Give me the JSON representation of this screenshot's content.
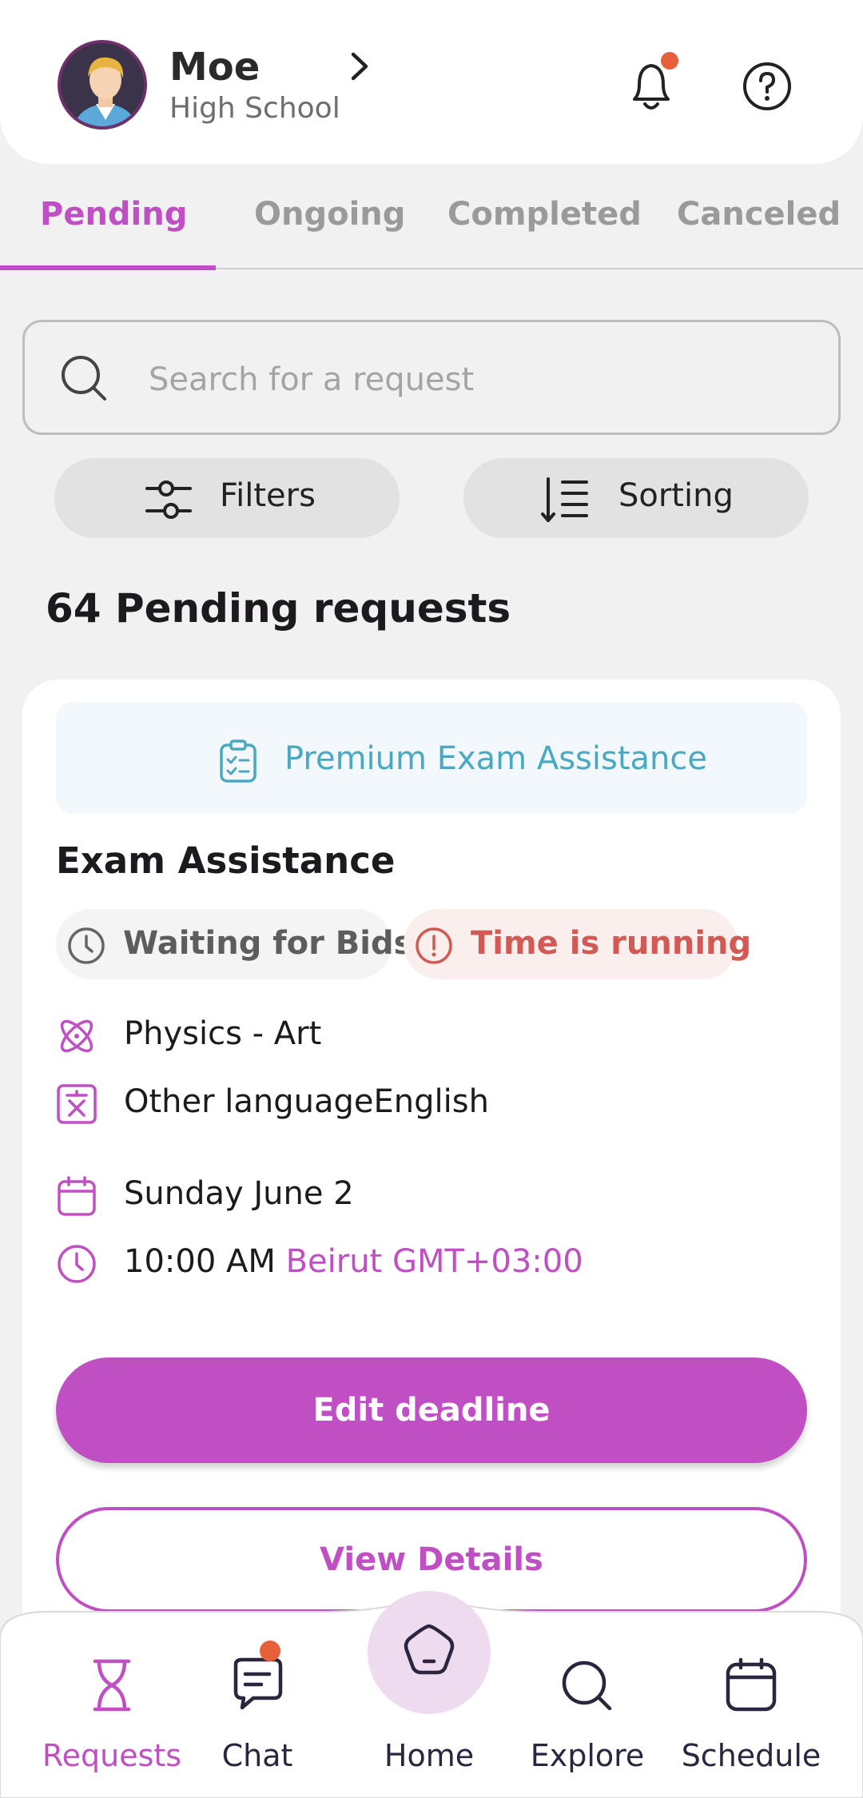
{
  "header": {
    "user_name": "Moe",
    "user_level": "High School",
    "icons": [
      "avatar",
      "chevron-right-icon",
      "bell-icon",
      "help-icon"
    ]
  },
  "tabs": [
    {
      "label": "Pending",
      "active": true
    },
    {
      "label": "Ongoing",
      "active": false
    },
    {
      "label": "Completed",
      "active": false
    },
    {
      "label": "Canceled",
      "active": false
    }
  ],
  "search": {
    "placeholder": "Search for a request",
    "value": ""
  },
  "toolbar": {
    "filters_label": "Filters",
    "sorting_label": "Sorting"
  },
  "summary": {
    "count_text": "64 Pending requests"
  },
  "request_card": {
    "banner": "Premium Exam Assistance",
    "title": "Exam Assistance",
    "status_badge": "Waiting for Bids",
    "urgency_badge": "Time is running",
    "subject": "Physics - Art",
    "language": "Other languageEnglish",
    "date": "Sunday June 2",
    "time": "10:00 AM",
    "timezone": "Beirut GMT+03:00",
    "edit_label": "Edit deadline",
    "details_label": "View Details"
  },
  "bottom_nav": [
    {
      "label": "Requests",
      "icon": "hourglass-icon",
      "active": true
    },
    {
      "label": "Chat",
      "icon": "chat-icon",
      "active": false
    },
    {
      "label": "Home",
      "icon": "home-icon",
      "active": false
    },
    {
      "label": "Explore",
      "icon": "search-icon",
      "active": false
    },
    {
      "label": "Schedule",
      "icon": "calendar-icon",
      "active": false
    }
  ],
  "colors": {
    "accent": "#c04fc4",
    "premium_text": "#4aa9c2",
    "urgent_text": "#d35a54",
    "notification_dot": "#e8603a"
  }
}
